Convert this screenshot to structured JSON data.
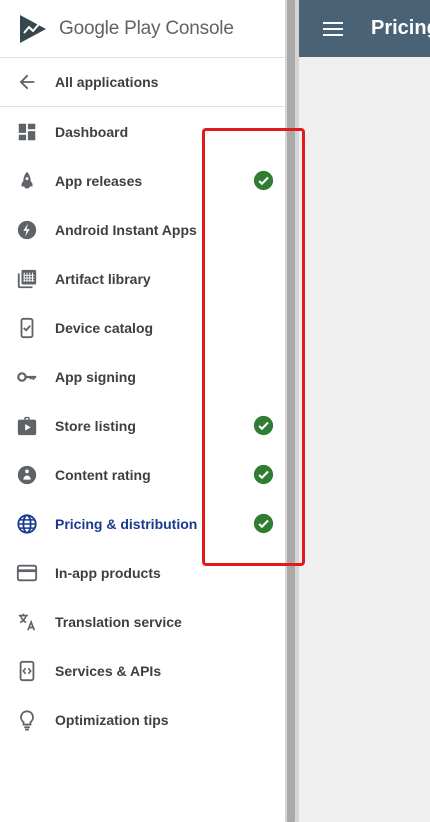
{
  "brand": {
    "title": "Google Play Console"
  },
  "back": {
    "label": "All applications",
    "icon": "arrow-back-icon"
  },
  "nav": [
    {
      "id": "dashboard",
      "label": "Dashboard",
      "icon": "dashboard-icon",
      "complete": false
    },
    {
      "id": "app-releases",
      "label": "App releases",
      "icon": "rocket-icon",
      "complete": true
    },
    {
      "id": "instant-apps",
      "label": "Android Instant Apps",
      "icon": "bolt-icon",
      "complete": false
    },
    {
      "id": "artifact-library",
      "label": "Artifact library",
      "icon": "library-icon",
      "complete": false
    },
    {
      "id": "device-catalog",
      "label": "Device catalog",
      "icon": "device-icon",
      "complete": false
    },
    {
      "id": "app-signing",
      "label": "App signing",
      "icon": "key-icon",
      "complete": false
    },
    {
      "id": "store-listing",
      "label": "Store listing",
      "icon": "store-icon",
      "complete": true
    },
    {
      "id": "content-rating",
      "label": "Content rating",
      "icon": "rating-icon",
      "complete": true
    },
    {
      "id": "pricing",
      "label": "Pricing & distribution",
      "icon": "globe-icon",
      "complete": true,
      "active": true
    },
    {
      "id": "in-app-products",
      "label": "In-app products",
      "icon": "card-icon",
      "complete": false
    },
    {
      "id": "translation",
      "label": "Translation service",
      "icon": "translate-icon",
      "complete": false
    },
    {
      "id": "services-apis",
      "label": "Services & APIs",
      "icon": "api-icon",
      "complete": false
    },
    {
      "id": "optimization",
      "label": "Optimization tips",
      "icon": "lightbulb-icon",
      "complete": false
    }
  ],
  "topbar": {
    "title": "Pricing"
  },
  "colors": {
    "accent": "#1a3a8f",
    "check": "#2e7d32",
    "topbar": "#4a6276",
    "annotation": "#e01b1b"
  }
}
